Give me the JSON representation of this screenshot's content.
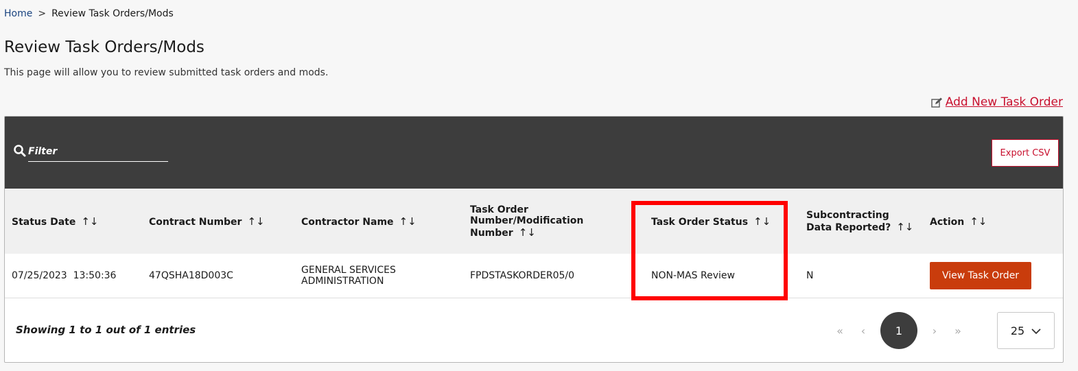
{
  "breadcrumb": {
    "home": "Home",
    "separator": ">",
    "current": "Review Task Orders/Mods"
  },
  "page": {
    "title": "Review Task Orders/Mods",
    "description": "This page will allow you to review submitted task orders and mods."
  },
  "actions": {
    "add_new": "Add New Task Order",
    "export_csv": "Export CSV"
  },
  "filter": {
    "placeholder": "Filter"
  },
  "table": {
    "columns": [
      "Status Date",
      "Contract Number",
      "Contractor Name",
      "Task Order Number/Modification Number",
      "Task Order Status",
      "Subcontracting Data Reported?",
      "Action"
    ],
    "sort_glyph": "↑↓",
    "rows": [
      {
        "status_date": "07/25/2023  13:50:36",
        "contract_number": "47QSHA18D003C",
        "contractor_name": "GENERAL SERVICES ADMINISTRATION",
        "task_order_number": "FPDSTASKORDER05/0",
        "task_order_status": "NON-MAS Review",
        "subcontracting": "N",
        "action": "View Task Order"
      }
    ]
  },
  "footer": {
    "entries": "Showing 1 to 1 out of 1 entries",
    "first": "«",
    "prev": "‹",
    "current_page": "1",
    "next": "›",
    "last": "»",
    "page_size": "25"
  },
  "colors": {
    "accent": "#c8102e",
    "button": "#c93c0c",
    "toolbar": "#3d3d3d",
    "highlight": "#ff0000"
  }
}
